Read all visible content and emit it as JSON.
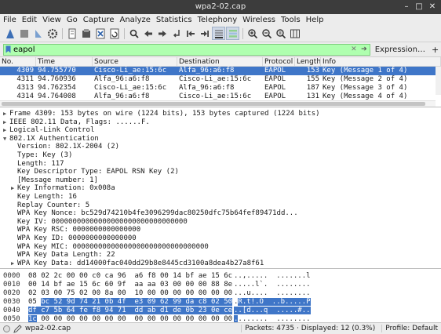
{
  "window": {
    "title": "wpa2-02.cap"
  },
  "menu": [
    "File",
    "Edit",
    "View",
    "Go",
    "Capture",
    "Analyze",
    "Statistics",
    "Telephony",
    "Wireless",
    "Tools",
    "Help"
  ],
  "toolbar_icons": [
    "shark-fin-icon",
    "stop-icon",
    "restart-icon",
    "options-gear-icon",
    "open-file-icon",
    "save-file-icon",
    "close-file-icon",
    "reload-icon",
    "find-icon",
    "back-icon",
    "forward-icon",
    "goto-packet-icon",
    "first-packet-icon",
    "last-packet-icon",
    "autoscroll-icon",
    "colorize-icon",
    "zoom-in-icon",
    "zoom-out-icon",
    "zoom-reset-icon",
    "resize-columns-icon"
  ],
  "filter": {
    "value": "eapol",
    "expression_label": "Expression…",
    "add_label": "+"
  },
  "packet_list": {
    "columns": [
      "No.",
      "Time",
      "Source",
      "Destination",
      "Protocol",
      "Length",
      "Info"
    ],
    "rows": [
      {
        "no": "4309",
        "time": "94.755770",
        "src": "Cisco-Li_ae:15:6c",
        "dst": "Alfa_96:a6:f8",
        "proto": "EAPOL",
        "len": "153",
        "info": "Key (Message 1 of 4)"
      },
      {
        "no": "4311",
        "time": "94.760936",
        "src": "Alfa_96:a6:f8",
        "dst": "Cisco-Li_ae:15:6c",
        "proto": "EAPOL",
        "len": "155",
        "info": "Key (Message 2 of 4)"
      },
      {
        "no": "4313",
        "time": "94.762354",
        "src": "Cisco-Li_ae:15:6c",
        "dst": "Alfa_96:a6:f8",
        "proto": "EAPOL",
        "len": "187",
        "info": "Key (Message 3 of 4)"
      },
      {
        "no": "4314",
        "time": "94.764008",
        "src": "Alfa_96:a6:f8",
        "dst": "Cisco-Li_ae:15:6c",
        "proto": "EAPOL",
        "len": "131",
        "info": "Key (Message 4 of 4)"
      }
    ]
  },
  "details": {
    "lines": [
      {
        "indent": 0,
        "tri": "right",
        "text": "Frame 4309: 153 bytes on wire (1224 bits), 153 bytes captured (1224 bits)"
      },
      {
        "indent": 0,
        "tri": "right",
        "text": "IEEE 802.11 Data, Flags: ......F."
      },
      {
        "indent": 0,
        "tri": "right",
        "text": "Logical-Link Control"
      },
      {
        "indent": 0,
        "tri": "down",
        "text": "802.1X Authentication"
      },
      {
        "indent": 1,
        "tri": "",
        "text": "Version: 802.1X-2004 (2)"
      },
      {
        "indent": 1,
        "tri": "",
        "text": "Type: Key (3)"
      },
      {
        "indent": 1,
        "tri": "",
        "text": "Length: 117"
      },
      {
        "indent": 1,
        "tri": "",
        "text": "Key Descriptor Type: EAPOL RSN Key (2)"
      },
      {
        "indent": 1,
        "tri": "",
        "text": "[Message number: 1]"
      },
      {
        "indent": 1,
        "tri": "right",
        "text": "Key Information: 0x008a"
      },
      {
        "indent": 1,
        "tri": "",
        "text": "Key Length: 16"
      },
      {
        "indent": 1,
        "tri": "",
        "text": "Replay Counter: 5"
      },
      {
        "indent": 1,
        "tri": "",
        "text": "WPA Key Nonce: bc529d74210b4fe3096299dac80250dfc75b64fef89471dd..."
      },
      {
        "indent": 1,
        "tri": "",
        "text": "Key IV: 00000000000000000000000000000000"
      },
      {
        "indent": 1,
        "tri": "",
        "text": "WPA Key RSC: 0000000000000000"
      },
      {
        "indent": 1,
        "tri": "",
        "text": "WPA Key ID: 0000000000000000"
      },
      {
        "indent": 1,
        "tri": "",
        "text": "WPA Key MIC: 00000000000000000000000000000000"
      },
      {
        "indent": 1,
        "tri": "",
        "text": "WPA Key Data Length: 22"
      },
      {
        "indent": 1,
        "tri": "right",
        "text": "WPA Key Data: dd14000fac040dd29b8e8445cd3100a8dea4b27a8f61"
      }
    ]
  },
  "hex": {
    "rows": [
      {
        "off": "0000",
        "pre": "08 02 2c 00 00 c0 ca 96  a6 f8 00 14 bf ae 15 6c",
        "hl": "",
        "post": "",
        "apre": "..,.....  .......l",
        "ahl": "",
        "apost": ""
      },
      {
        "off": "0010",
        "pre": "00 14 bf ae 15 6c 60 9f  aa aa 03 00 00 00 88 8e",
        "hl": "",
        "post": "",
        "apre": ".....l`.  ........",
        "ahl": "",
        "apost": ""
      },
      {
        "off": "0020",
        "pre": "02 03 00 75 02 00 8a 00  10 00 00 00 00 00 00 00",
        "hl": "",
        "post": "",
        "apre": "...u....  ........",
        "ahl": "",
        "apost": ""
      },
      {
        "off": "0030",
        "pre": "05 ",
        "hl": "bc 52 9d 74 21 0b 4f  e3 09 62 99 da c8 02 50",
        "post": "",
        "apre": ".",
        "ahl": "R.t!.O  ..b.....P",
        "apost": ""
      },
      {
        "off": "0040",
        "pre": "",
        "hl": "df c7 5b 64 fe f8 94 71  dd ab d1 de 0b 23 0e ce",
        "post": "",
        "apre": "",
        "ahl": "..[d...q  .....#..",
        "apost": ""
      },
      {
        "off": "0050",
        "pre": "",
        "hl": "1c",
        "post": " 00 00 00 00 00 00 00  00 00 00 00 00 00 00 00",
        "apre": "",
        "ahl": ".",
        "apost": ".......  ........"
      }
    ]
  },
  "status": {
    "file": "wpa2-02.cap",
    "packets": "Packets: 4735 · Displayed: 12 (0.3%)",
    "profile": "Profile: Default"
  }
}
